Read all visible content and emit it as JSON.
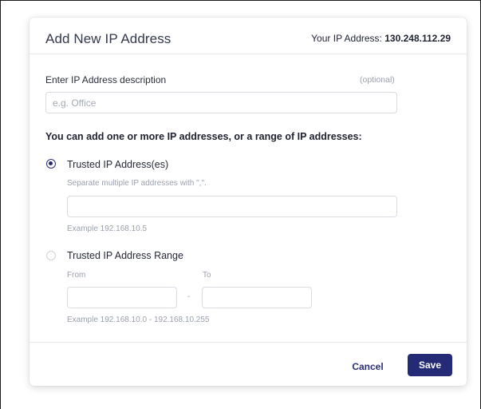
{
  "modal": {
    "title": "Add New IP Address",
    "your_ip_label": "Your IP Address:",
    "your_ip_value": "130.248.112.29"
  },
  "description": {
    "label": "Enter IP Address description",
    "optional_text": "(optional)",
    "placeholder": "e.g. Office",
    "value": ""
  },
  "section_heading": "You can add one or more IP addresses, or a range of IP addresses:",
  "trusted_addresses": {
    "label": "Trusted IP Address(es)",
    "selected": true,
    "hint": "Separate multiple IP addresses with \",\".",
    "value": "",
    "example": "Example 192.168.10.5"
  },
  "trusted_range": {
    "label": "Trusted IP Address Range",
    "selected": false,
    "from_label": "From",
    "to_label": "To",
    "separator": "-",
    "from_value": "",
    "to_value": "",
    "example": "Example 192.168.10.0 - 192.168.10.255"
  },
  "footer": {
    "cancel_label": "Cancel",
    "save_label": "Save"
  },
  "colors": {
    "accent": "#252a77",
    "border": "#d9dce2",
    "muted_text": "#9aa0ac"
  }
}
